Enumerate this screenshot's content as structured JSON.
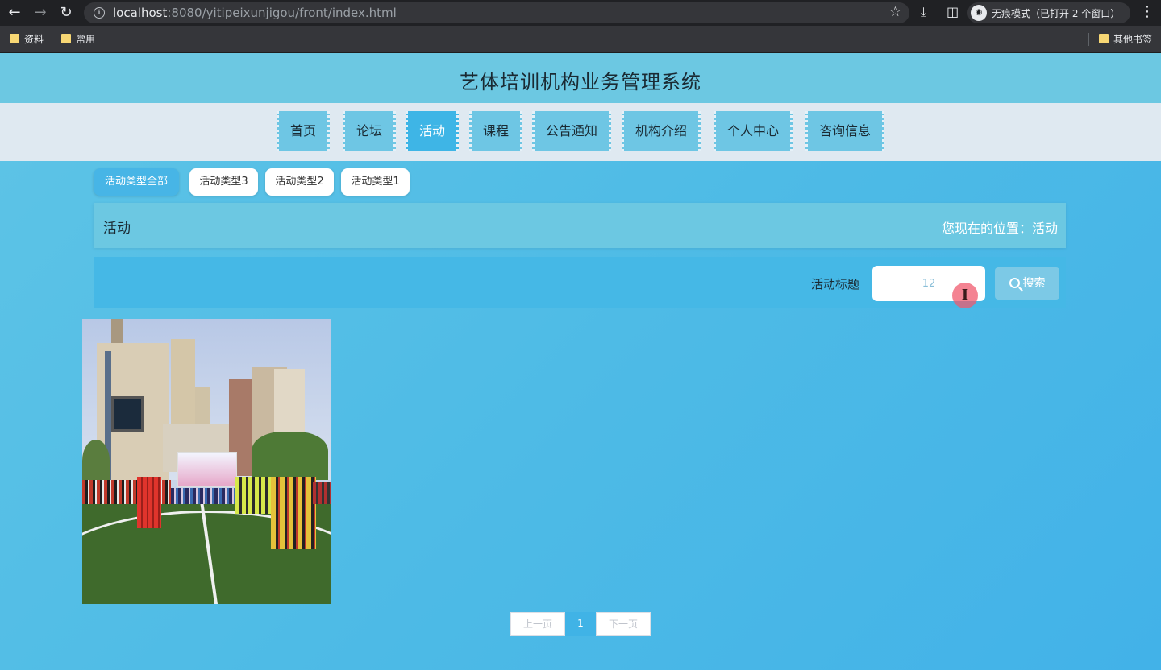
{
  "browser": {
    "url_host": "localhost",
    "url_rest": ":8080/yitipeixunjigou/front/index.html",
    "incognito_label": "无痕模式（已打开 2 个窗口）",
    "bookmarks": [
      "资料",
      "常用"
    ],
    "other_bookmarks": "其他书签"
  },
  "site": {
    "title": "艺体培训机构业务管理系统"
  },
  "nav": {
    "items": [
      "首页",
      "论坛",
      "活动",
      "课程",
      "公告通知",
      "机构介绍",
      "个人中心",
      "咨询信息"
    ],
    "active": "活动"
  },
  "categories": {
    "items": [
      "活动类型全部",
      "活动类型3",
      "活动类型2",
      "活动类型1"
    ],
    "active": "活动类型全部"
  },
  "breadcrumb": {
    "title": "活动",
    "position": "您现在的位置：活动"
  },
  "search": {
    "label": "活动标题",
    "value": "12",
    "button": "搜索"
  },
  "pagination": {
    "prev": "上一页",
    "current": "1",
    "next": "下一页"
  },
  "colors": {
    "header": "#6cc8e2",
    "accent": "#40b3e6",
    "nav_bg": "#dfe9f1"
  }
}
